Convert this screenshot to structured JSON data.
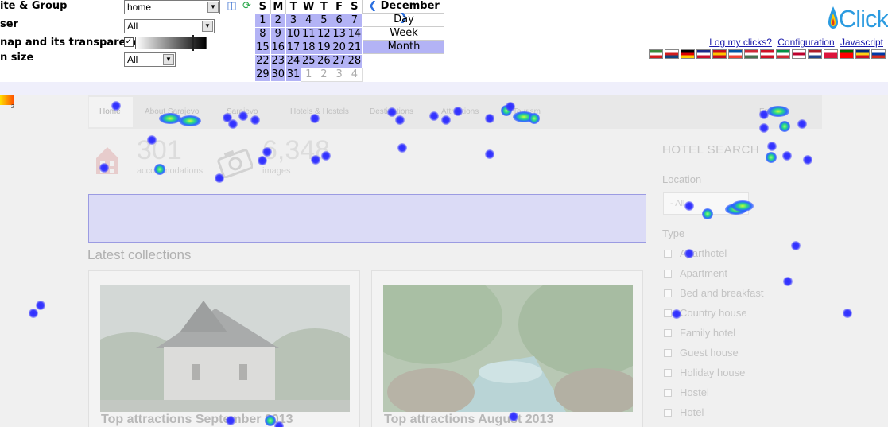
{
  "toolbar": {
    "site_group_label": "ite & Group",
    "site_group_value": "home",
    "user_label": "ser",
    "user_value": "All",
    "heatmap_label": "nap and its transparency",
    "screen_size_label": "n size",
    "screen_size_value": "All",
    "heatmap_checked": "✓"
  },
  "calendar": {
    "weekdays": [
      "S",
      "M",
      "T",
      "W",
      "T",
      "F",
      "S"
    ],
    "weeks": [
      [
        "1",
        "2",
        "3",
        "4",
        "5",
        "6",
        "7"
      ],
      [
        "8",
        "9",
        "10",
        "11",
        "12",
        "13",
        "14"
      ],
      [
        "15",
        "16",
        "17",
        "18",
        "19",
        "20",
        "21"
      ],
      [
        "22",
        "23",
        "24",
        "25",
        "26",
        "27",
        "28"
      ],
      [
        "29",
        "30",
        "31",
        "1",
        "2",
        "3",
        "4"
      ]
    ],
    "month": "December",
    "prev": "❮",
    "next": "❯",
    "views": [
      "Day",
      "Week",
      "Month"
    ]
  },
  "app": {
    "logo": "Click",
    "links": [
      "Log my clicks?",
      "Configuration",
      "Javascript"
    ],
    "flag_colors": [
      [
        "#3a8a3a",
        "#ffffff",
        "#d01e1e"
      ],
      [
        "#ffffff",
        "#d01e1e",
        "#11457e"
      ],
      [
        "#000000",
        "#dd0000",
        "#ffce00"
      ],
      [
        "#1a2a8a",
        "#ffffff",
        "#c8102e"
      ],
      [
        "#c60b1e",
        "#ffc400",
        "#c60b1e"
      ],
      [
        "#0055a4",
        "#ffffff",
        "#ef4135"
      ],
      [
        "#ce2939",
        "#ffffff",
        "#477050"
      ],
      [
        "#ce1126",
        "#ffffff",
        "#ce1126"
      ],
      [
        "#009246",
        "#ffffff",
        "#ce2b37"
      ],
      [
        "#ffffff",
        "#bc002d",
        "#ffffff"
      ],
      [
        "#ae1c28",
        "#ffffff",
        "#21468b"
      ],
      [
        "#ffffff",
        "#dc143c",
        "#dc143c"
      ],
      [
        "#006600",
        "#ff0000",
        "#ff0000"
      ],
      [
        "#002b7f",
        "#fcd116",
        "#ce1126"
      ],
      [
        "#ffffff",
        "#0039a6",
        "#d52b1e"
      ]
    ]
  },
  "legend": {
    "max": "2"
  },
  "site": {
    "nav": [
      "Home",
      "About Sarajevo",
      "Sarajevo",
      "Hotels & Hostels",
      "Destinations",
      "Attractions",
      "Tourism"
    ],
    "language": "English",
    "stat_accommodations_num": "301",
    "stat_accommodations_label": "accommodations",
    "stat_images_num": "6,348",
    "stat_images_label": "images",
    "latest_collections": "Latest collections",
    "cards": [
      "Top attractions September 2013",
      "Top attractions August 2013"
    ],
    "hotel_search": "HOTEL SEARCH",
    "location_label": "Location",
    "location_placeholder": "- All -",
    "type_label": "Type",
    "types": [
      "Aparthotel",
      "Apartment",
      "Bed and breakfast",
      "Country house",
      "Family hotel",
      "Guest house",
      "Holiday house",
      "Hostel",
      "Hotel"
    ]
  }
}
